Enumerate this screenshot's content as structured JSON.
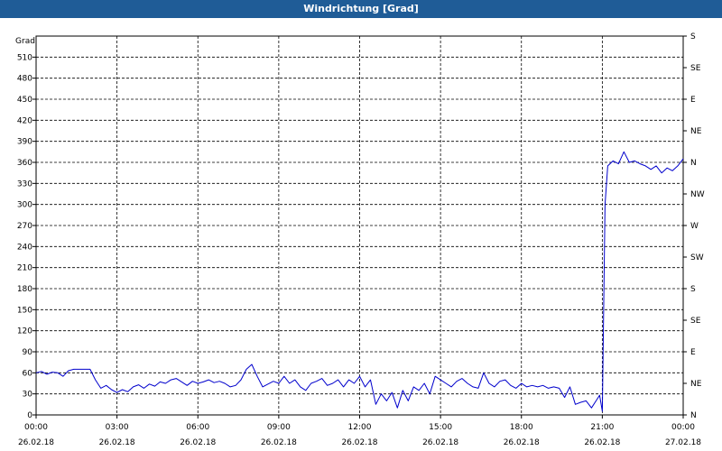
{
  "window": {
    "title": "Windrichtung [Grad]"
  },
  "chart_data": {
    "type": "line",
    "title": "Windrichtung [Grad]",
    "ylabel": "Grad",
    "xlabel": "",
    "ylim": [
      0,
      540
    ],
    "yticks": [
      0,
      30,
      60,
      90,
      120,
      150,
      180,
      210,
      240,
      270,
      300,
      330,
      360,
      390,
      420,
      450,
      480,
      510
    ],
    "xlim": [
      0,
      24
    ],
    "xticks": [
      {
        "h": 0,
        "time": "00:00",
        "date": "26.02.18"
      },
      {
        "h": 3,
        "time": "03:00",
        "date": "26.02.18"
      },
      {
        "h": 6,
        "time": "06:00",
        "date": "26.02.18"
      },
      {
        "h": 9,
        "time": "09:00",
        "date": "26.02.18"
      },
      {
        "h": 12,
        "time": "12:00",
        "date": "26.02.18"
      },
      {
        "h": 15,
        "time": "15:00",
        "date": "26.02.18"
      },
      {
        "h": 18,
        "time": "18:00",
        "date": "26.02.18"
      },
      {
        "h": 21,
        "time": "21:00",
        "date": "26.02.18"
      },
      {
        "h": 24,
        "time": "00:00",
        "date": "27.02.18"
      }
    ],
    "right_axis": [
      {
        "v": 0,
        "label": "N"
      },
      {
        "v": 45,
        "label": "NE"
      },
      {
        "v": 90,
        "label": "E"
      },
      {
        "v": 135,
        "label": "SE"
      },
      {
        "v": 180,
        "label": "S"
      },
      {
        "v": 225,
        "label": "SW"
      },
      {
        "v": 270,
        "label": "W"
      },
      {
        "v": 315,
        "label": "NW"
      },
      {
        "v": 360,
        "label": "N"
      },
      {
        "v": 405,
        "label": "NE"
      },
      {
        "v": 450,
        "label": "E"
      },
      {
        "v": 495,
        "label": "SE"
      },
      {
        "v": 540,
        "label": "S"
      }
    ],
    "grid": true,
    "series": [
      {
        "color": "#0000cc",
        "x": [
          0,
          0.2,
          0.4,
          0.6,
          0.8,
          1.0,
          1.2,
          1.4,
          1.6,
          1.8,
          2.0,
          2.2,
          2.4,
          2.6,
          2.8,
          3.0,
          3.2,
          3.4,
          3.6,
          3.8,
          4.0,
          4.2,
          4.4,
          4.6,
          4.8,
          5.0,
          5.2,
          5.4,
          5.6,
          5.8,
          6.0,
          6.2,
          6.4,
          6.6,
          6.8,
          7.0,
          7.2,
          7.4,
          7.6,
          7.8,
          8.0,
          8.2,
          8.4,
          8.6,
          8.8,
          9.0,
          9.2,
          9.4,
          9.6,
          9.8,
          10.0,
          10.2,
          10.4,
          10.6,
          10.8,
          11.0,
          11.2,
          11.4,
          11.6,
          11.8,
          12.0,
          12.2,
          12.4,
          12.6,
          12.8,
          13.0,
          13.2,
          13.4,
          13.6,
          13.8,
          14.0,
          14.2,
          14.4,
          14.6,
          14.8,
          15.0,
          15.2,
          15.4,
          15.6,
          15.8,
          16.0,
          16.2,
          16.4,
          16.6,
          16.8,
          17.0,
          17.2,
          17.4,
          17.6,
          17.8,
          18.0,
          18.2,
          18.4,
          18.6,
          18.8,
          19.0,
          19.2,
          19.4,
          19.6,
          19.8,
          20.0,
          20.2,
          20.4,
          20.6,
          20.8,
          20.9,
          21.0,
          21.1,
          21.2,
          21.4,
          21.6,
          21.8,
          22.0,
          22.2,
          22.4,
          22.6,
          22.8,
          23.0,
          23.2,
          23.4,
          23.6,
          23.8,
          24.0
        ],
        "y": [
          60,
          62,
          58,
          61,
          60,
          55,
          63,
          65,
          65,
          65,
          65,
          50,
          38,
          42,
          36,
          32,
          36,
          33,
          40,
          43,
          38,
          44,
          41,
          47,
          45,
          50,
          52,
          47,
          42,
          48,
          45,
          47,
          50,
          46,
          48,
          45,
          40,
          42,
          50,
          65,
          72,
          55,
          40,
          44,
          48,
          45,
          55,
          45,
          50,
          40,
          35,
          45,
          48,
          52,
          42,
          45,
          50,
          40,
          50,
          45,
          55,
          40,
          50,
          15,
          30,
          20,
          32,
          10,
          35,
          20,
          40,
          35,
          45,
          30,
          55,
          50,
          45,
          40,
          48,
          52,
          45,
          40,
          38,
          60,
          45,
          40,
          48,
          50,
          42,
          38,
          45,
          40,
          42,
          40,
          42,
          38,
          40,
          38,
          25,
          40,
          15,
          18,
          20,
          10,
          22,
          28,
          5,
          300,
          355,
          362,
          358,
          375,
          360,
          362,
          358,
          355,
          350,
          355,
          345,
          352,
          348,
          355,
          365
        ]
      }
    ]
  }
}
